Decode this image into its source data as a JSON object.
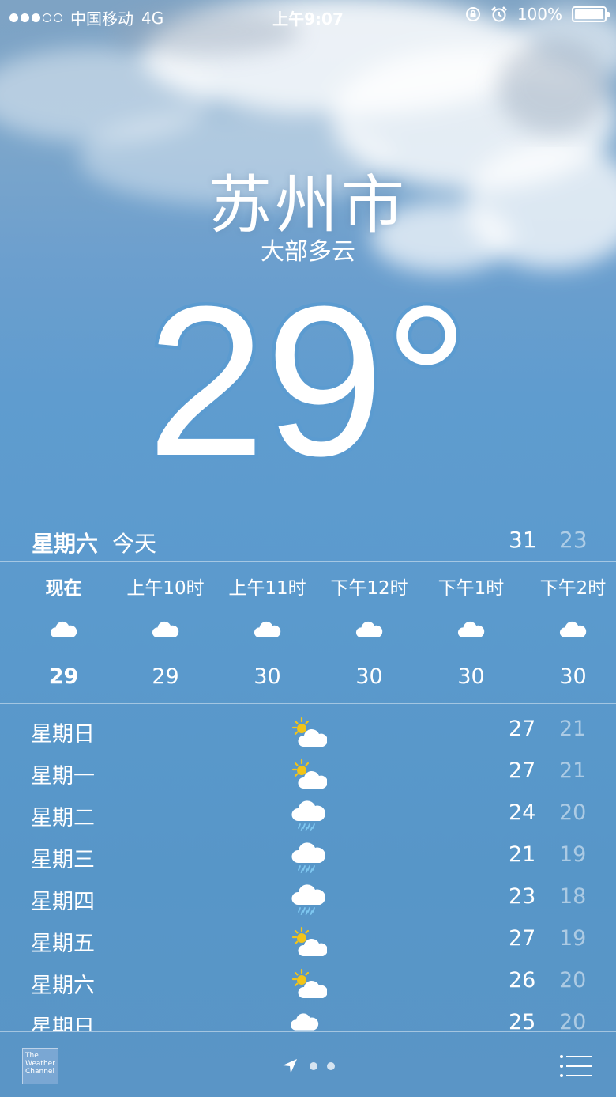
{
  "status_bar": {
    "carrier": "中国移动",
    "network": "4G",
    "time": "上午9:07",
    "battery": "100%",
    "signal_strength": 3,
    "signal_max": 5,
    "battery_level": 1.0
  },
  "location": {
    "city": "苏州市",
    "condition": "大部多云",
    "temperature": "29°"
  },
  "today": {
    "day": "星期六",
    "label": "今天",
    "high": "31",
    "low": "23"
  },
  "hourly": [
    {
      "time": "现在",
      "temp": "29",
      "icon": "cloud-icon"
    },
    {
      "time": "上午10时",
      "temp": "29",
      "icon": "cloud-icon"
    },
    {
      "time": "上午11时",
      "temp": "30",
      "icon": "cloud-icon"
    },
    {
      "time": "下午12时",
      "temp": "30",
      "icon": "cloud-icon"
    },
    {
      "time": "下午1时",
      "temp": "30",
      "icon": "cloud-icon"
    },
    {
      "time": "下午2时",
      "temp": "30",
      "icon": "cloud-icon"
    }
  ],
  "daily": [
    {
      "day": "星期日",
      "icon": "partly-sunny-icon",
      "high": "27",
      "low": "21"
    },
    {
      "day": "星期一",
      "icon": "partly-sunny-icon",
      "high": "27",
      "low": "21"
    },
    {
      "day": "星期二",
      "icon": "rain-cloud-icon",
      "high": "24",
      "low": "20"
    },
    {
      "day": "星期三",
      "icon": "rain-cloud-icon",
      "high": "21",
      "low": "19"
    },
    {
      "day": "星期四",
      "icon": "rain-cloud-icon",
      "high": "23",
      "low": "18"
    },
    {
      "day": "星期五",
      "icon": "partly-sunny-icon",
      "high": "27",
      "low": "19"
    },
    {
      "day": "星期六",
      "icon": "partly-sunny-icon",
      "high": "26",
      "low": "20"
    },
    {
      "day": "星期日",
      "icon": "cloud-icon",
      "high": "25",
      "low": "20"
    }
  ],
  "toolbar": {
    "logo_text": "The Weather Channel",
    "page_count": 2,
    "current_page": 1
  },
  "colors": {
    "sky_top": "#7ea3c4",
    "sky_bottom": "#5a95c6",
    "sun": "#f2c418",
    "rain": "#7ec7f0"
  }
}
